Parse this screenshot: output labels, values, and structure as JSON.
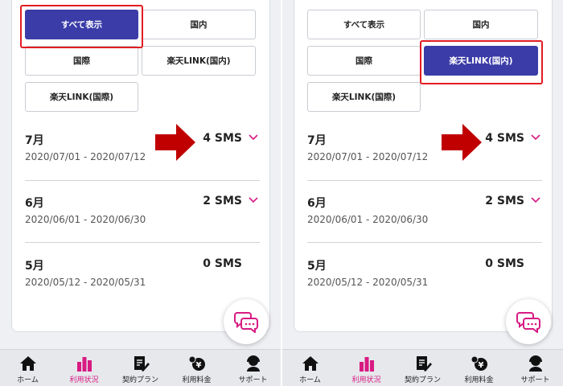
{
  "colors": {
    "accent": "#3b3ca8",
    "highlight": "#e31b23",
    "pink": "#d81b83",
    "arrow": "#c00000"
  },
  "filters": {
    "all": "すべて表示",
    "domestic": "国内",
    "international": "国際",
    "link_domestic": "楽天LINK(国内)",
    "link_international": "楽天LINK(国際)"
  },
  "months": [
    {
      "label": "7月",
      "range": "2020/07/01 - 2020/07/12",
      "count": "4 SMS",
      "expandable": true
    },
    {
      "label": "6月",
      "range": "2020/06/01 - 2020/06/30",
      "count": "2 SMS",
      "expandable": true
    },
    {
      "label": "5月",
      "range": "2020/05/12 - 2020/05/31",
      "count": "0 SMS",
      "expandable": false
    }
  ],
  "tabs": [
    {
      "label": "ホーム",
      "icon": "home-icon"
    },
    {
      "label": "利用状況",
      "icon": "usage-chart-icon",
      "active": true
    },
    {
      "label": "契約プラン",
      "icon": "contract-plan-icon"
    },
    {
      "label": "利用料金",
      "icon": "yen-fee-icon"
    },
    {
      "label": "サポート",
      "icon": "support-headset-icon"
    }
  ],
  "panels": {
    "left": {
      "selected_filter": "all"
    },
    "right": {
      "selected_filter": "link_domestic"
    }
  }
}
